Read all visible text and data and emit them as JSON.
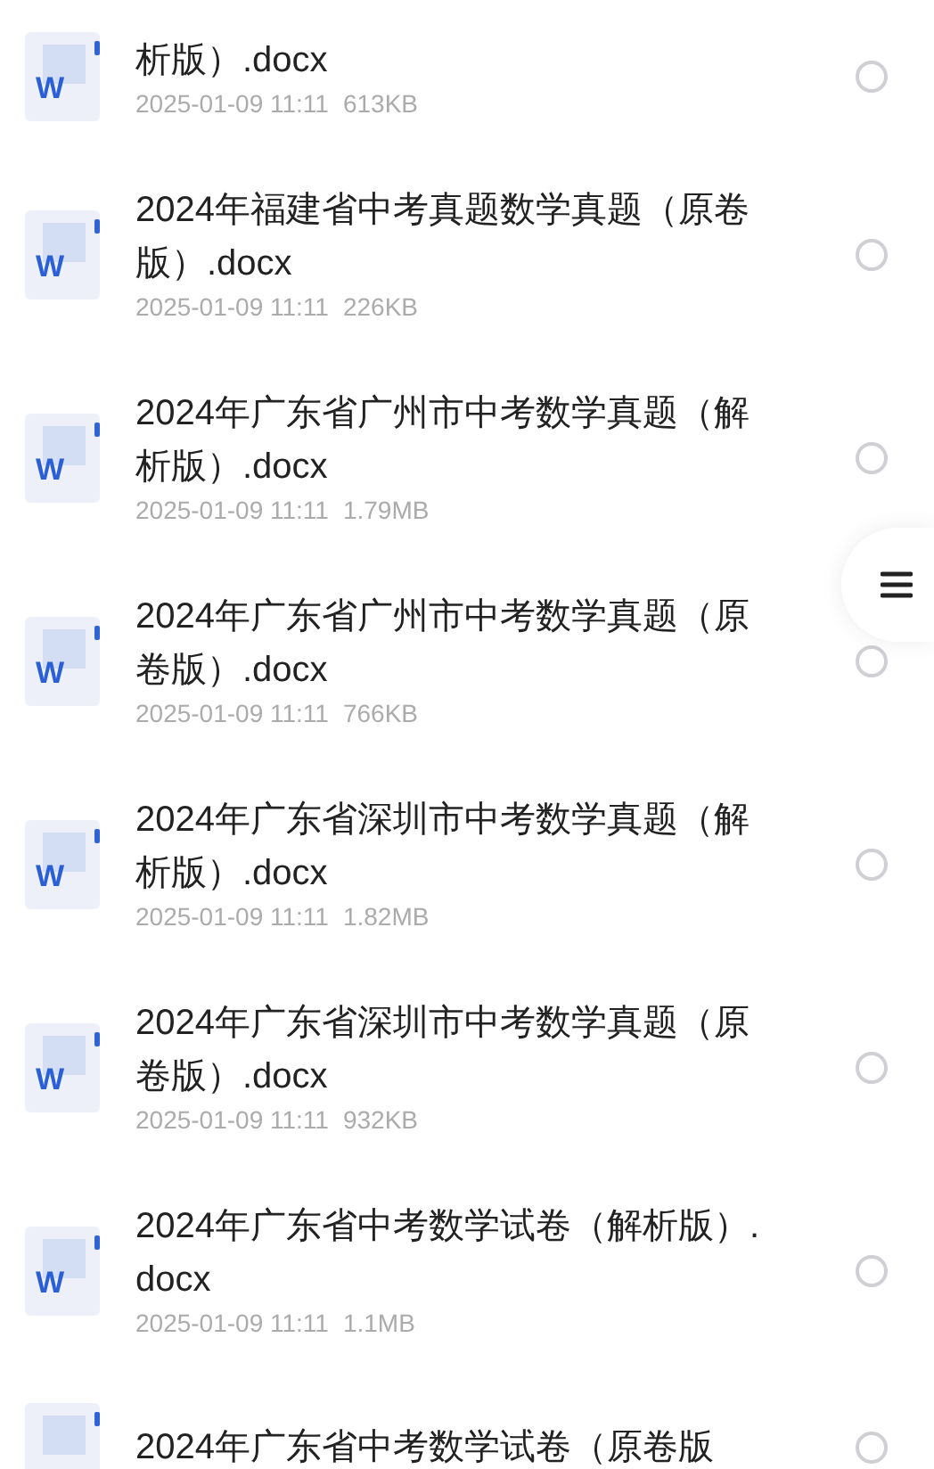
{
  "files": [
    {
      "icon_text": "W",
      "title": "析版）.docx",
      "date": "2025-01-09 11:11",
      "size": "613KB",
      "selected": false
    },
    {
      "icon_text": "W",
      "title": "2024年福建省中考真题数学真题（原卷版）.docx",
      "date": "2025-01-09 11:11",
      "size": "226KB",
      "selected": false
    },
    {
      "icon_text": "W",
      "title": "2024年广东省广州市中考数学真题（解析版）.docx",
      "date": "2025-01-09 11:11",
      "size": "1.79MB",
      "selected": false
    },
    {
      "icon_text": "W",
      "title": "2024年广东省广州市中考数学真题（原卷版）.docx",
      "date": "2025-01-09 11:11",
      "size": "766KB",
      "selected": false
    },
    {
      "icon_text": "W",
      "title": "2024年广东省深圳市中考数学真题（解析版）.docx",
      "date": "2025-01-09 11:11",
      "size": "1.82MB",
      "selected": false
    },
    {
      "icon_text": "W",
      "title": "2024年广东省深圳市中考数学真题（原卷版）.docx",
      "date": "2025-01-09 11:11",
      "size": "932KB",
      "selected": false
    },
    {
      "icon_text": "W",
      "title": "2024年广东省中考数学试卷（解析版）.docx",
      "date": "2025-01-09 11:11",
      "size": "1.1MB",
      "selected": false
    },
    {
      "title": "2024年广东省中考数学试卷（原卷版",
      "selected": false
    }
  ]
}
